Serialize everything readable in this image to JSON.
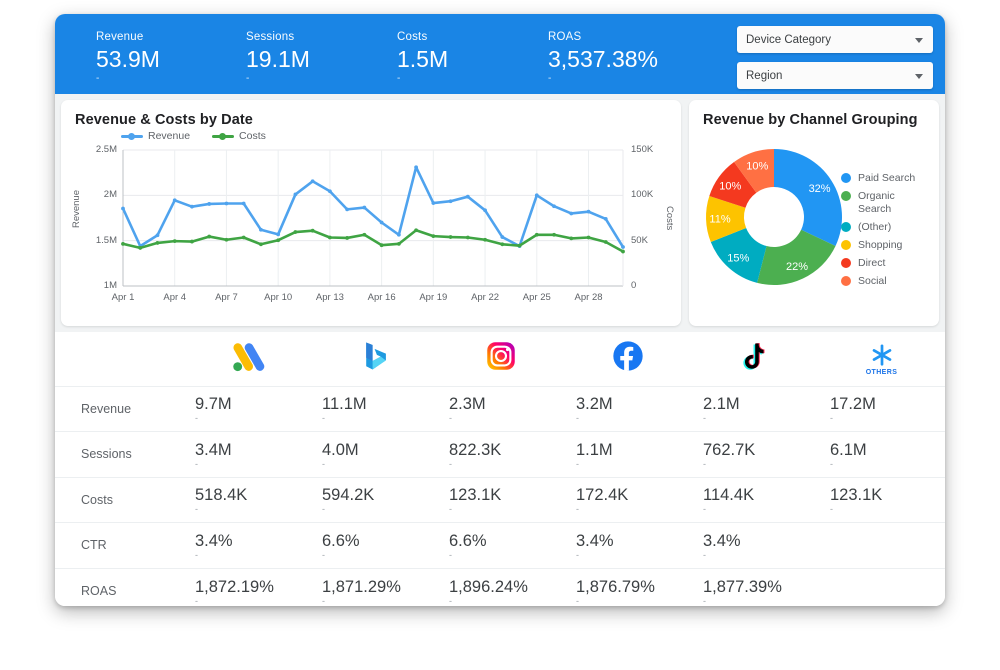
{
  "header": {
    "kpis": [
      {
        "label": "Revenue",
        "value": "53.9M",
        "sub": "-"
      },
      {
        "label": "Sessions",
        "value": "19.1M",
        "sub": "-"
      },
      {
        "label": "Costs",
        "value": "1.5M",
        "sub": "-"
      },
      {
        "label": "ROAS",
        "value": "3,537.38%",
        "sub": "-"
      }
    ],
    "filters": [
      {
        "label": "Device Category",
        "icon": "chevron-down-icon"
      },
      {
        "label": "Region",
        "icon": "chevron-down-icon"
      }
    ],
    "accent_color": "#1a85e5"
  },
  "line_card": {
    "title": "Revenue & Costs by Date"
  },
  "donut_card": {
    "title": "Revenue by Channel Grouping"
  },
  "table": {
    "columns": [
      {
        "icon": "google-ads-icon",
        "name": "Google Ads"
      },
      {
        "icon": "bing-icon",
        "name": "Bing"
      },
      {
        "icon": "instagram-icon",
        "name": "Instagram"
      },
      {
        "icon": "facebook-icon",
        "name": "Facebook"
      },
      {
        "icon": "tiktok-icon",
        "name": "TikTok"
      },
      {
        "icon": "others-icon",
        "name": "OTHERS"
      }
    ],
    "others_icon_label": "OTHERS",
    "rows": [
      {
        "label": "Revenue",
        "values": [
          "9.7M",
          "11.1M",
          "2.3M",
          "3.2M",
          "2.1M",
          "17.2M"
        ],
        "subs": [
          "-",
          "-",
          "-",
          "-",
          "-",
          "-"
        ]
      },
      {
        "label": "Sessions",
        "values": [
          "3.4M",
          "4.0M",
          "822.3K",
          "1.1M",
          "762.7K",
          "6.1M"
        ],
        "subs": [
          "-",
          "-",
          "-",
          "-",
          "-",
          "-"
        ]
      },
      {
        "label": "Costs",
        "values": [
          "518.4K",
          "594.2K",
          "123.1K",
          "172.4K",
          "114.4K",
          "123.1K"
        ],
        "subs": [
          "-",
          "-",
          "-",
          "-",
          "-",
          "-"
        ]
      },
      {
        "label": "CTR",
        "values": [
          "3.4%",
          "6.6%",
          "6.6%",
          "3.4%",
          "3.4%",
          ""
        ],
        "subs": [
          "-",
          "-",
          "-",
          "-",
          "-",
          ""
        ]
      },
      {
        "label": "ROAS",
        "values": [
          "1,872.19%",
          "1,871.29%",
          "1,896.24%",
          "1,876.79%",
          "1,877.39%",
          ""
        ],
        "subs": [
          "-",
          "-",
          "-",
          "-",
          "-",
          ""
        ]
      }
    ]
  },
  "chart_data": [
    {
      "type": "line",
      "title": "Revenue & Costs by Date",
      "xlabel": "",
      "ylabel": "Revenue",
      "y2label": "Costs",
      "ylim": [
        1000000,
        2500000
      ],
      "y2lim": [
        0,
        150000
      ],
      "yticks": [
        "1M",
        "1.5M",
        "2M",
        "2.5M"
      ],
      "y2ticks": [
        "0",
        "50K",
        "100K",
        "150K"
      ],
      "grid": true,
      "legend_position": "top-left",
      "x": [
        "Apr 1",
        "Apr 2",
        "Apr 3",
        "Apr 4",
        "Apr 5",
        "Apr 6",
        "Apr 7",
        "Apr 8",
        "Apr 9",
        "Apr 10",
        "Apr 11",
        "Apr 12",
        "Apr 13",
        "Apr 14",
        "Apr 15",
        "Apr 16",
        "Apr 17",
        "Apr 18",
        "Apr 19",
        "Apr 20",
        "Apr 21",
        "Apr 22",
        "Apr 23",
        "Apr 24",
        "Apr 25",
        "Apr 26",
        "Apr 27",
        "Apr 28",
        "Apr 29",
        "Apr 30"
      ],
      "xticks": [
        "Apr 1",
        "Apr 4",
        "Apr 7",
        "Apr 10",
        "Apr 13",
        "Apr 16",
        "Apr 19",
        "Apr 22",
        "Apr 25",
        "Apr 28"
      ],
      "series": [
        {
          "name": "Revenue",
          "color": "#4fa3ee",
          "axis": "left",
          "values": [
            1855000,
            1440000,
            1560000,
            1945000,
            1875000,
            1905000,
            1910000,
            1910000,
            1620000,
            1570000,
            2010000,
            2155000,
            2045000,
            1845000,
            1865000,
            1700000,
            1565000,
            2310000,
            1915000,
            1935000,
            1985000,
            1835000,
            1540000,
            1440000,
            2000000,
            1880000,
            1800000,
            1820000,
            1740000,
            1430000
          ]
        },
        {
          "name": "Costs",
          "color": "#3fa443",
          "axis": "right",
          "values": [
            46500,
            42000,
            47500,
            49500,
            49000,
            54500,
            51000,
            53500,
            46000,
            50500,
            59500,
            61000,
            53500,
            53000,
            56500,
            45000,
            46500,
            61500,
            55000,
            54000,
            53500,
            51000,
            46000,
            44500,
            56500,
            56500,
            52500,
            53500,
            48500,
            38000
          ]
        }
      ]
    },
    {
      "type": "pie",
      "title": "Revenue by Channel Grouping",
      "donut": true,
      "legend_position": "right",
      "labels": [
        "Paid Search",
        "Organic Search",
        "(Other)",
        "Shopping",
        "Direct",
        "Social"
      ],
      "values": [
        32,
        22,
        15,
        11,
        10,
        10
      ],
      "display_labels": [
        "32%",
        "22%",
        "15%",
        "11%",
        "10%",
        "10%"
      ],
      "colors": [
        "#2196f3",
        "#4caf50",
        "#00acc1",
        "#fdc300",
        "#f4391f",
        "#ff7043"
      ]
    }
  ]
}
